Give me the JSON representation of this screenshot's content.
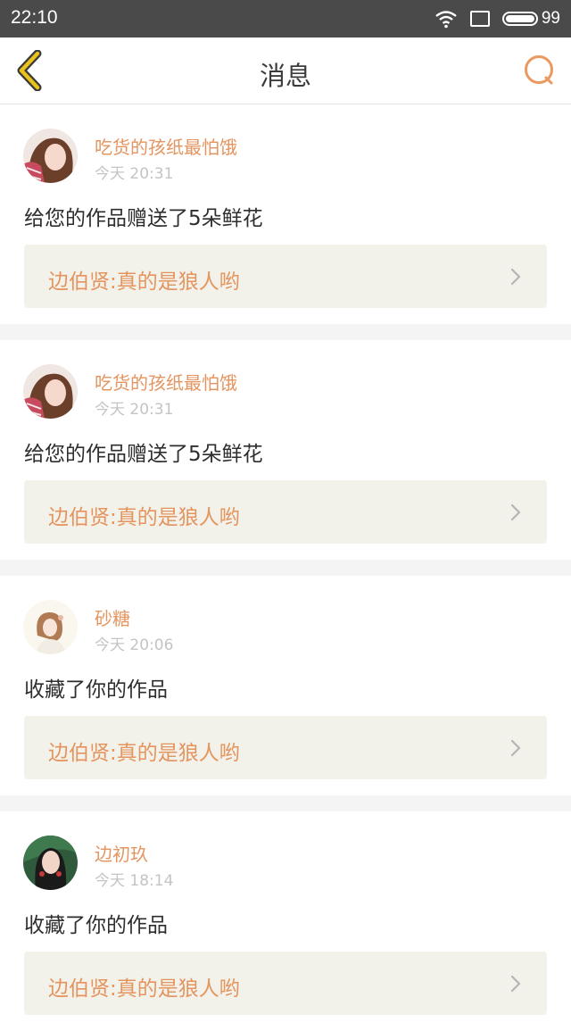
{
  "status_bar": {
    "time": "22:10",
    "battery": "99"
  },
  "header": {
    "title": "消息"
  },
  "colors": {
    "accent": "#e4955f",
    "back_arrow": "#e9c21a",
    "reply_bg": "#f2f2ea"
  },
  "messages": [
    {
      "user": "吃货的孩纸最怕饿",
      "time": "今天 20:31",
      "text": "给您的作品赠送了5朵鲜花",
      "reply": "边伯贤:真的是狼人哟"
    },
    {
      "user": "吃货的孩纸最怕饿",
      "time": "今天 20:31",
      "text": "给您的作品赠送了5朵鲜花",
      "reply": "边伯贤:真的是狼人哟"
    },
    {
      "user": "砂糖",
      "time": "今天 20:06",
      "text": "收藏了你的作品",
      "reply": "边伯贤:真的是狼人哟"
    },
    {
      "user": "边初玖",
      "time": "今天 18:14",
      "text": "收藏了你的作品",
      "reply": "边伯贤:真的是狼人哟"
    }
  ]
}
